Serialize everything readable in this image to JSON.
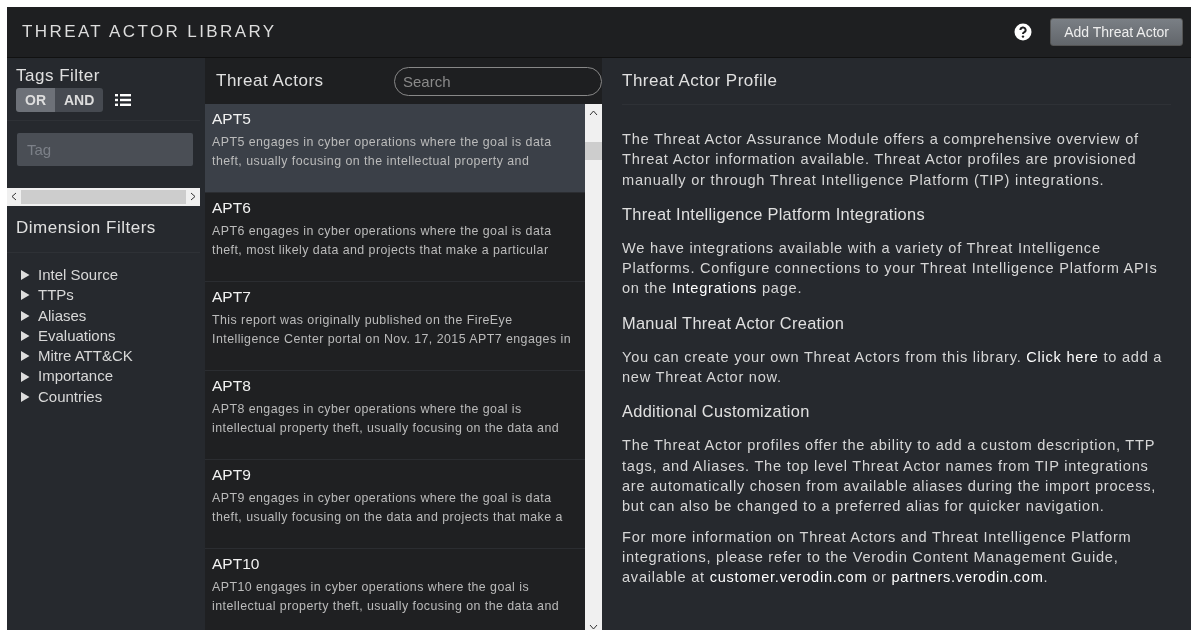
{
  "header": {
    "title": "THREAT ACTOR LIBRARY",
    "add_button": "Add Threat Actor"
  },
  "tags_filter": {
    "title": "Tags Filter",
    "modes": [
      {
        "label": "OR",
        "selected": true
      },
      {
        "label": "AND",
        "selected": false
      }
    ],
    "tag_field": {
      "placeholder": "Tag"
    }
  },
  "dimension_filters": {
    "title": "Dimension Filters",
    "items": [
      {
        "label": "Intel Source",
        "expanded": false
      },
      {
        "label": "TTPs",
        "expanded": false
      },
      {
        "label": "Aliases",
        "expanded": false
      },
      {
        "label": "Evaluations",
        "expanded": false
      },
      {
        "label": "Mitre ATT&CK",
        "expanded": false
      },
      {
        "label": "Importance",
        "expanded": false
      },
      {
        "label": "Countries",
        "expanded": false
      }
    ]
  },
  "threat_actors": {
    "title": "Threat Actors",
    "search": {
      "placeholder": "Search"
    },
    "items": [
      {
        "name": "APT5",
        "description": "APT5 engages in cyber operations where the goal is data theft, usually focusing on the intellectual property and",
        "selected": true
      },
      {
        "name": "APT6",
        "description": "APT6 engages in cyber operations where the goal is data theft, most likely data and projects that make a particular",
        "selected": false
      },
      {
        "name": "APT7",
        "description": "This report was originally published on the FireEye Intelligence Center portal on Nov. 17, 2015 APT7 engages in",
        "selected": false
      },
      {
        "name": "APT8",
        "description": "APT8 engages in cyber operations where the goal is intellectual property theft, usually focusing on the data and",
        "selected": false
      },
      {
        "name": "APT9",
        "description": "APT9 engages in cyber operations where the goal is data theft, usually focusing on the data and projects that make a",
        "selected": false
      },
      {
        "name": "APT10",
        "description": "APT10 engages in cyber operations where the goal is intellectual property theft, usually focusing on the data and",
        "selected": false
      }
    ]
  },
  "profile": {
    "title": "Threat Actor Profile",
    "sections": [
      {
        "kind": "paragraph",
        "text": "The Threat Actor Assurance Module offers a comprehensive overview of Threat Actor information available. Threat Actor profiles are provisioned manually or through Threat Intelligence Platform (TIP) integrations."
      },
      {
        "kind": "heading",
        "text": "Threat Intelligence Platform Integrations"
      },
      {
        "kind": "paragraph",
        "text": "We have integrations available with a variety of Threat Intelligence Platforms. Configure connections to your Threat Intelligence Platform APIs on the **Integrations** page."
      },
      {
        "kind": "heading",
        "text": "Manual Threat Actor Creation"
      },
      {
        "kind": "paragraph",
        "text": "You can create your own Threat Actors from this library. **Click here** to add a new Threat Actor now."
      },
      {
        "kind": "heading",
        "text": "Additional Customization"
      },
      {
        "kind": "paragraph",
        "text": "The Threat Actor profiles offer the ability to add a custom description, TTP tags, and Aliases. The top level Threat Actor names from TIP integrations are automatically chosen from available aliases during the import process, but can also be changed to a preferred alias for quicker navigation."
      },
      {
        "kind": "paragraph",
        "text": "For more information on Threat Actors and Threat Intelligence Platform integrations, please refer to the Verodin Content Management Guide, available at **customer.verodin.com** or **partners.verodin.com**."
      }
    ]
  }
}
